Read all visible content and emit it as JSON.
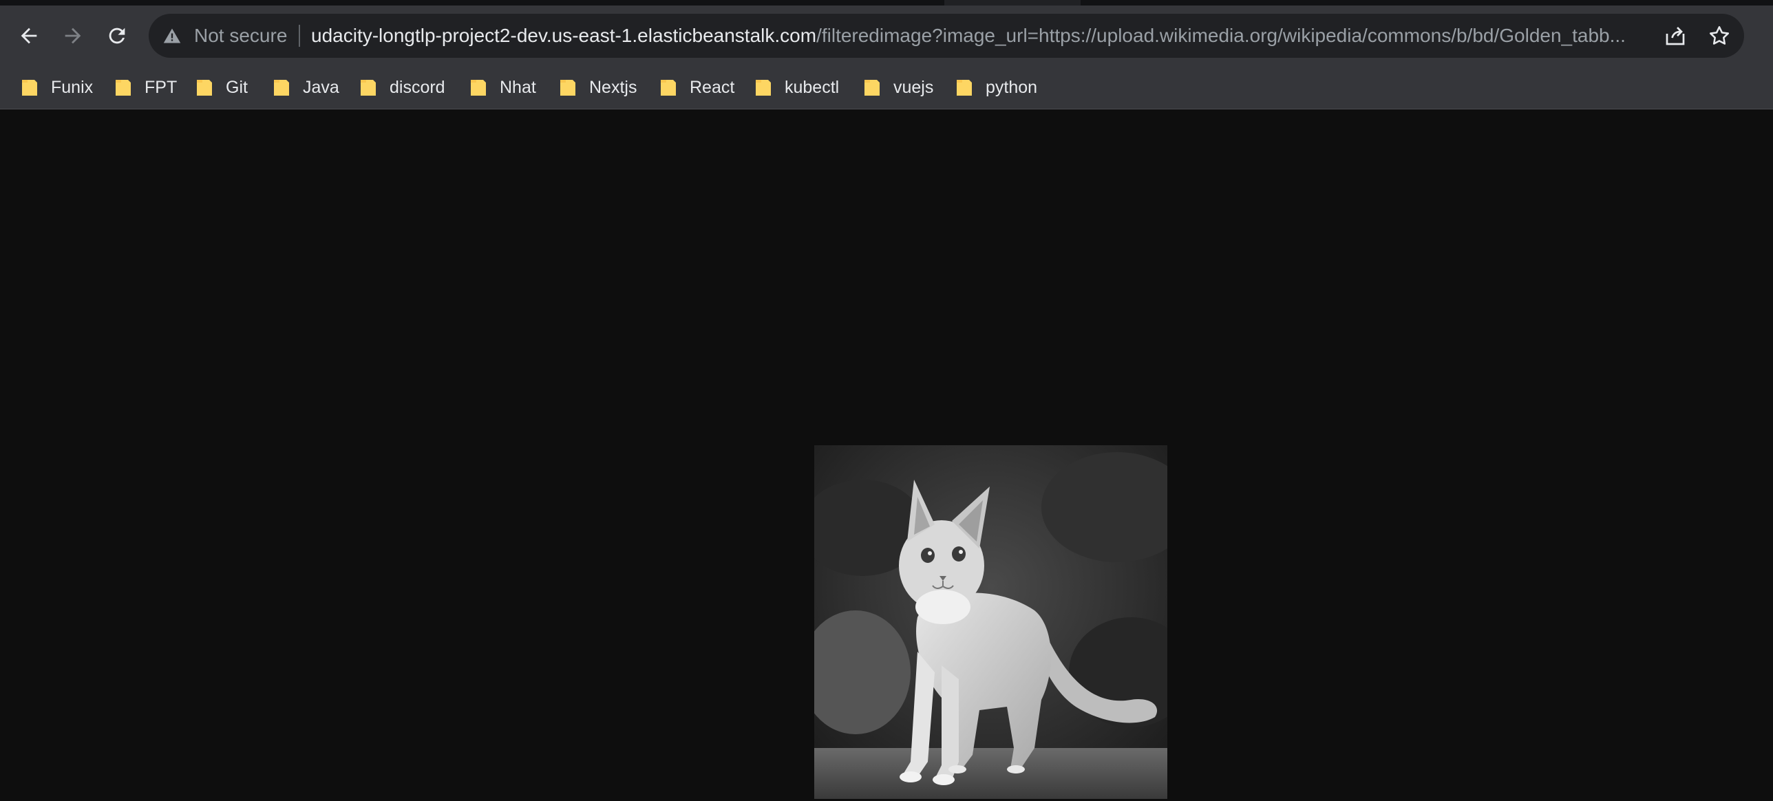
{
  "window": {
    "security_label": "Not secure",
    "url_host": "udacity-longtlp-project2-dev.us-east-1.elasticbeanstalk.com",
    "url_path": "/filteredimage?image_url=https://upload.wikimedia.org/wikipedia/commons/b/bd/Golden_tabb..."
  },
  "toolbar": {
    "icons": [
      "back-arrow-icon",
      "forward-arrow-icon",
      "reload-icon",
      "warning-triangle-icon",
      "share-icon",
      "star-icon"
    ]
  },
  "bookmarks": [
    {
      "label": "Funix",
      "icon": "folder-icon"
    },
    {
      "label": "FPT",
      "icon": "folder-icon"
    },
    {
      "label": "Git",
      "icon": "folder-icon"
    },
    {
      "label": "Java",
      "icon": "folder-icon"
    },
    {
      "label": "discord",
      "icon": "folder-icon"
    },
    {
      "label": "Nhat",
      "icon": "folder-icon"
    },
    {
      "label": "Nextjs",
      "icon": "folder-icon"
    },
    {
      "label": "React",
      "icon": "folder-icon"
    },
    {
      "label": "kubectl",
      "icon": "folder-icon"
    },
    {
      "label": "vuejs",
      "icon": "folder-icon"
    },
    {
      "label": "python",
      "icon": "folder-icon"
    }
  ],
  "colors": {
    "chrome_bg": "#35363a",
    "omnibox_bg": "#202124",
    "page_bg": "#0e0e0e",
    "folder_yellow": "#fdd663",
    "text_primary": "#e8eaed",
    "text_secondary": "#9aa0a6"
  }
}
